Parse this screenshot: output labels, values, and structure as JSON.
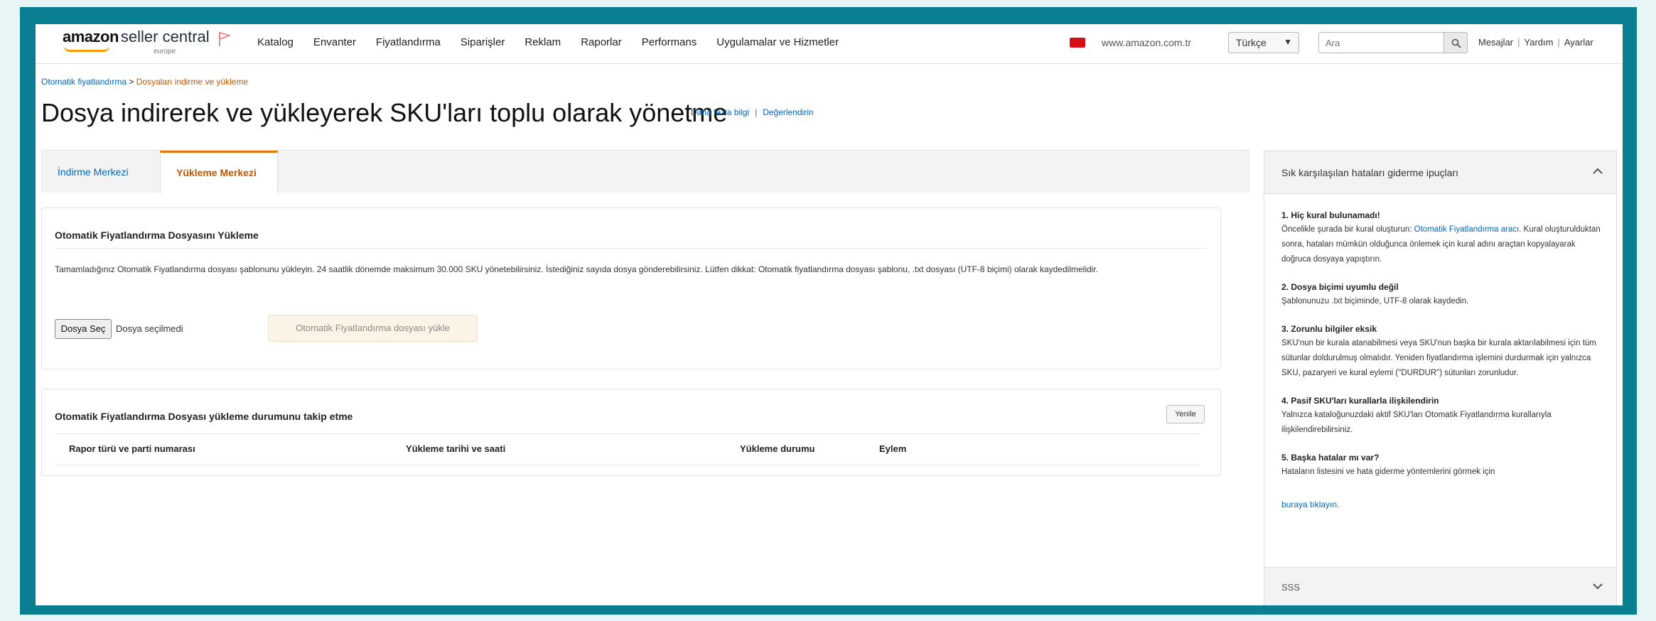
{
  "header": {
    "logo_brand": "amazon",
    "logo_product": "seller central",
    "logo_region": "europe",
    "nav": [
      "Katalog",
      "Envanter",
      "Fiyatlandırma",
      "Siparişler",
      "Reklam",
      "Raporlar",
      "Performans",
      "Uygulamalar ve Hizmetler"
    ],
    "marketplace": "www.amazon.com.tr",
    "language": "Türkçe",
    "search_placeholder": "Ara",
    "links": [
      "Mesajlar",
      "Yardım",
      "Ayarlar"
    ],
    "colors": {
      "logo_smile": "#ff9900",
      "tr_flag": "#d40e14"
    }
  },
  "breadcrumb": {
    "parent": "Otomatik fiyatlandırma",
    "separator": ">",
    "current": "Dosyaları indirme ve yükleme"
  },
  "page": {
    "title": "Dosya indirerek ve yükleyerek SKU'ları toplu olarak yönetme",
    "learn_more": "Daha fazla bilgi",
    "separator": "|",
    "rate": "Değerlendirin"
  },
  "tabs": [
    {
      "label": "İndirme Merkezi",
      "active": false
    },
    {
      "label": "Yükleme Merkezi",
      "active": true
    }
  ],
  "upload_card": {
    "title": "Otomatik Fiyatlandırma Dosyasını Yükleme",
    "description": "Tamamladığınız Otomatik Fiyatlandırma dosyası şablonunu yükleyin. 24 saatlik dönemde maksimum 30.000 SKU yönetebilirsiniz. İstediğiniz sayıda dosya gönderebilirsiniz. Lütfen dikkat: Otomatik fiyatlandırma dosyası şablonu, .txt dosyası (UTF-8 biçimi) olarak kaydedilmelidir.",
    "choose_file": "Dosya Seç",
    "no_file": "Dosya seçilmedi",
    "upload_button": "Otomatik Fiyatlandırma dosyası yükle"
  },
  "status_card": {
    "title": "Otomatik Fiyatlandırma Dosyası yükleme durumunu takip etme",
    "refresh": "Yenile",
    "columns": [
      "Rapor türü ve parti numarası",
      "Yükleme tarihi ve saati",
      "Yükleme durumu",
      "Eylem"
    ]
  },
  "side_panel": {
    "title": "Sık karşılaşılan hataları giderme ipuçları",
    "tips": [
      {
        "title": "1. Hiç kural bulunamadı!",
        "body_before": "Öncelikle şurada bir kural oluşturun: ",
        "body_link": "Otomatik Fiyatlandırma aracı.",
        "body_after": " Kural oluşturulduktan sonra, hataları mümkün olduğunca önlemek için kural adını araçtan kopyalayarak doğruca dosyaya yapıştırın."
      },
      {
        "title": "2. Dosya biçimi uyumlu değil",
        "body_before": "Şablonunuzu .txt biçiminde, UTF-8 olarak kaydedin.",
        "body_link": "",
        "body_after": ""
      },
      {
        "title": "3. Zorunlu bilgiler eksik",
        "body_before": "SKU'nun bir kurala atanabilmesi veya SKU'nun başka bir kurala aktarılabilmesi için tüm sütunlar doldurulmuş olmalıdır. Yeniden fiyatlandırma işlemini durdurmak için yalnızca SKU, pazaryeri ve kural eylemi (\"DURDUR\") sütunları zorunludur.",
        "body_link": "",
        "body_after": ""
      },
      {
        "title": "4. Pasif SKU'ları kurallarla ilişkilendirin",
        "body_before": "Yalnızca kataloğunuzdaki aktif SKU'ları Otomatik Fiyatlandırma kurallarıyla ilişkilendirebilirsiniz.",
        "body_link": "",
        "body_after": ""
      },
      {
        "title": "5. Başka hatalar mı var?",
        "body_before": "Hataların listesini ve hata giderme yöntemlerini görmek için",
        "body_link": "",
        "body_after": ""
      }
    ],
    "more_link": "buraya tıklayın.",
    "faq": "SSS"
  }
}
